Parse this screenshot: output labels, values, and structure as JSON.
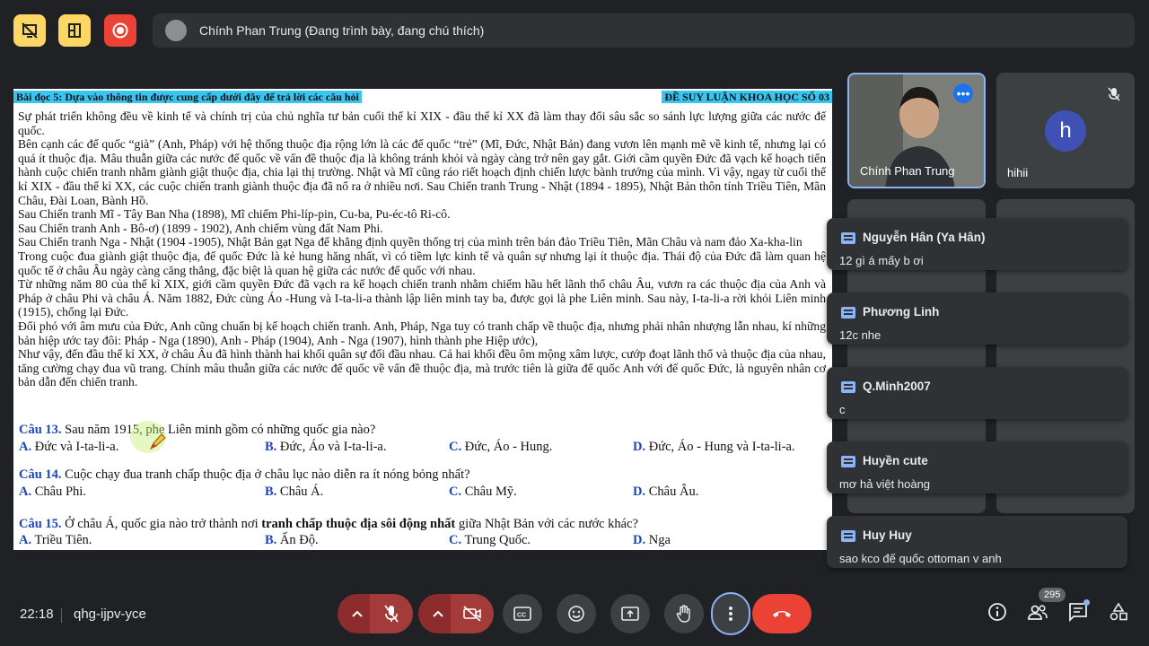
{
  "topbar": {
    "presenter_label": "Chính Phan Trung (Đang trình bày, đang chú thích)"
  },
  "document": {
    "header_left": "Bài đọc 5: Dựa vào thông tin được cung cấp dưới đây để trả lời các câu hỏi",
    "header_right": "ĐỀ SUY LUẬN KHOA HỌC SỐ 03",
    "paragraphs": [
      "Sự phát triển không đều về kinh tế và chính trị của chủ nghĩa tư bản cuối thế kỉ XIX - đầu thế kỉ XX đã làm thay đổi sâu sắc so sánh lực lượng giữa các nước đế quốc.",
      "Bên cạnh các đế quốc “già” (Anh, Pháp) với hệ thống thuộc địa rộng lớn là các đế quốc “trẻ” (Mĩ, Đức, Nhật Bản) đang vươn lên mạnh mẽ về kinh tế, nhưng lại có quá ít thuộc địa. Mâu thuẫn giữa các nước đế quốc về vấn đề thuộc địa là không tránh khỏi và ngày càng trở nên gay gắt. Giới cầm quyền Đức đã vạch kế hoạch tiến hành cuộc chiến tranh nhằm giành giật thuộc địa, chia lại thị trường. Nhật và Mĩ cũng ráo riết hoạch định chiến lược bành trướng của mình. Vì vậy, ngay từ cuối thế kỉ XIX - đầu thế kỉ XX, các cuộc chiến tranh giành thuộc địa đã nổ ra ở nhiều nơi. Sau Chiến tranh Trung - Nhật (1894 - 1895), Nhật Bản thôn tính Triều Tiên, Mãn Châu, Đài Loan, Bành Hồ.",
      "Sau Chiến tranh Mĩ - Tây Ban Nha (1898), Mĩ chiếm Phi-líp-pin, Cu-ba, Pu-éc-tô Ri-cô.",
      "Sau Chiến tranh Anh - Bô-ơ) (1899 - 1902), Anh chiếm vùng đất Nam Phi.",
      "Sau Chiến tranh Nga - Nhật (1904 -1905), Nhật Bản gạt Nga để khẳng định quyền thống trị của mình trên bán đảo Triều Tiên, Mãn Châu và nam đảo Xa-kha-lin",
      "Trong cuộc đua giành giật thuộc địa, đế quốc Đức là kẻ hung hăng nhất, vì có tiềm lực kinh tế và quân sự nhưng lại ít thuộc địa. Thái độ của Đức đã làm quan hệ quốc tế ở châu Âu ngày càng căng thẳng, đặc biệt là quan hệ giữa các nước đế quốc với nhau.",
      "Từ những năm 80 của thế kỉ XIX, giới cầm quyền Đức đã vạch ra kế hoạch chiến tranh nhằm chiếm hầu hết lãnh thổ châu Âu, vươn ra các thuộc địa của Anh và Pháp ở châu Phi và châu Á. Năm 1882, Đức cùng Áo -Hung và I-ta-li-a thành lập liên minh tay ba, được gọi là phe Liên minh. Sau này, I-ta-li-a rời khỏi Liên minh (1915), chống lại Đức.",
      "Đối phó với âm mưu của Đức, Anh cũng chuẩn bị kế hoạch chiến tranh. Anh, Pháp, Nga tuy có tranh chấp về thuộc địa, nhưng phải nhân nhượng lẫn nhau, kí những bản hiệp ước tay đôi: Pháp - Nga (1890), Anh - Pháp (1904), Anh - Nga (1907), hình thành phe Hiệp ước),",
      "Như vậy, đến đầu thế kỉ XX, ở châu Âu đã hình thành hai khối quân sự đối đầu nhau. Cả hai khối đều ôm mộng xâm lược, cướp đoạt lãnh thổ và thuộc địa của nhau, tăng cường chạy đua vũ trang. Chính mâu thuẫn giữa các nước đế quốc về vấn đề thuộc địa, mà trước tiên là giữa đế quốc Anh với đế quốc Đức, là nguyên nhân cơ bản dẫn đến chiến tranh."
    ],
    "questions": [
      {
        "num": "Câu 13.",
        "text": " Sau năm 1915, phe Liên minh gồm có những quốc gia nào?",
        "options": [
          [
            "A.",
            " Đức và I-ta-li-a."
          ],
          [
            "B.",
            " Đức, Áo và I-ta-li-a."
          ],
          [
            "C.",
            " Đức, Áo - Hung."
          ],
          [
            "D.",
            " Đức, Áo - Hung và I-ta-li-a."
          ]
        ]
      },
      {
        "num": "Câu 14.",
        "text": " Cuộc chạy đua tranh chấp thuộc địa ở châu lục nào diễn ra ít nóng bỏng nhất?",
        "options": [
          [
            "A.",
            " Châu Phi."
          ],
          [
            "B.",
            " Châu Á."
          ],
          [
            "C.",
            " Châu Mỹ."
          ],
          [
            "D.",
            " Châu Âu."
          ]
        ]
      },
      {
        "num": "Câu 15.",
        "text_pre": " Ở châu Á, quốc gia nào trở thành nơi ",
        "text_bold": "tranh chấp thuộc địa sôi động nhất",
        "text_post": " giữa Nhật Bản với các nước khác?",
        "options": [
          [
            "A.",
            " Triều Tiên."
          ],
          [
            "B.",
            " Ấn Độ."
          ],
          [
            "C.",
            " Trung Quốc."
          ],
          [
            "D.",
            " Nga"
          ]
        ]
      }
    ]
  },
  "participants": [
    {
      "name": "Chính Phan Trung"
    },
    {
      "name": "hihii",
      "initial": "h"
    }
  ],
  "chat_messages": [
    {
      "sender": "Nguyễn Hân (Ya Hân)",
      "message": "12 gì á mấy b ơi"
    },
    {
      "sender": "Phương Linh",
      "message": "12c nhe"
    },
    {
      "sender": "Q.Minh2007",
      "message": "c"
    },
    {
      "sender": "Huyền cute",
      "message": "mơ hả việt hoàng"
    },
    {
      "sender": "Huy Huy",
      "message": "sao kco đế quốc ottoman v anh"
    }
  ],
  "bottom": {
    "time": "22:18",
    "meeting_code": "qhg-ijpv-yce",
    "participant_count": "295"
  },
  "colors": {
    "accent_yellow": "#fdd663",
    "record_red": "#ea4335",
    "mic_off_red": "#8c2c2c",
    "end_call_red": "#ea4335",
    "doc_header_blue": "#38c6f0"
  }
}
